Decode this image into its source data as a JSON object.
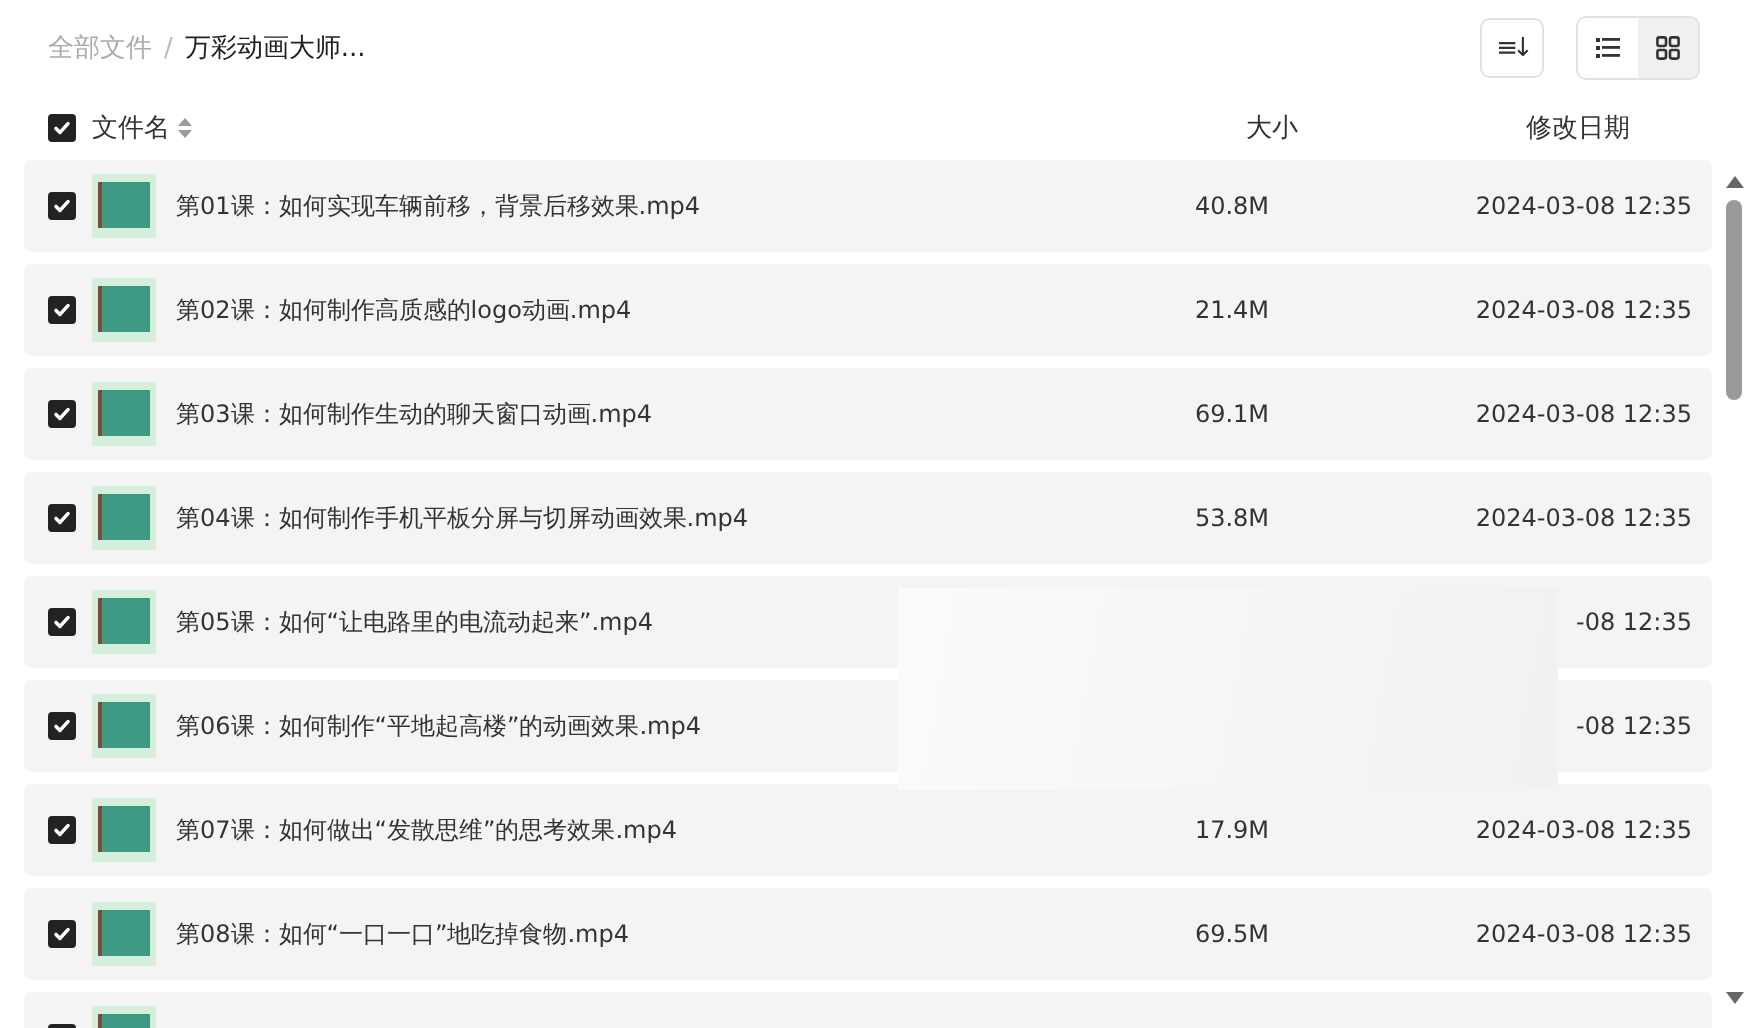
{
  "breadcrumb": [
    {
      "label": "全部文件",
      "current": false
    },
    {
      "separator": "/"
    },
    {
      "label": "万彩动画大师...",
      "current": true
    }
  ],
  "sort_button": {
    "icon": "≡↓"
  },
  "view_toggle": [
    {
      "kind": "list",
      "selected": true
    },
    {
      "kind": "grid",
      "selected": false
    }
  ],
  "table": {
    "select_all": {
      "checked": true
    },
    "columns": [
      {
        "label": "文件名",
        "sortable": true
      },
      {
        "label": "大小",
        "sortable": false
      },
      {
        "label": "修改日期",
        "sortable": false
      }
    ],
    "rows": [
      {
        "checked": true,
        "name": "第01课：如何实现车辆前移，背景后移效果.mp4",
        "size": "40.8M",
        "date": "2024-03-08 12:35"
      },
      {
        "checked": true,
        "name": "第02课：如何制作高质感的logo动画.mp4",
        "size": "21.4M",
        "date": "2024-03-08 12:35"
      },
      {
        "checked": true,
        "name": "第03课：如何制作生动的聊天窗口动画.mp4",
        "size": "69.1M",
        "date": "2024-03-08 12:35"
      },
      {
        "checked": true,
        "name": "第04课：如何制作手机平板分屏与切屏动画效果.mp4",
        "size": "53.8M",
        "date": "2024-03-08 12:35"
      },
      {
        "checked": true,
        "name": "第05课：如何“让电路里的电流动起来”.mp4",
        "date": "-08 12:35"
      },
      {
        "checked": true,
        "name": "第06课：如何制作“平地起高楼”的动画效果.mp4",
        "date": "-08 12:35"
      },
      {
        "checked": true,
        "name": "第07课：如何做出“发散思维”的思考效果.mp4",
        "size": "17.9M",
        "date": "2024-03-08 12:35"
      },
      {
        "checked": true,
        "name": "第08课：如何“一口一口”地吃掉食物.mp4",
        "size": "69.5M",
        "date": "2024-03-08 12:35"
      },
      {
        "checked": true
      }
    ]
  }
}
